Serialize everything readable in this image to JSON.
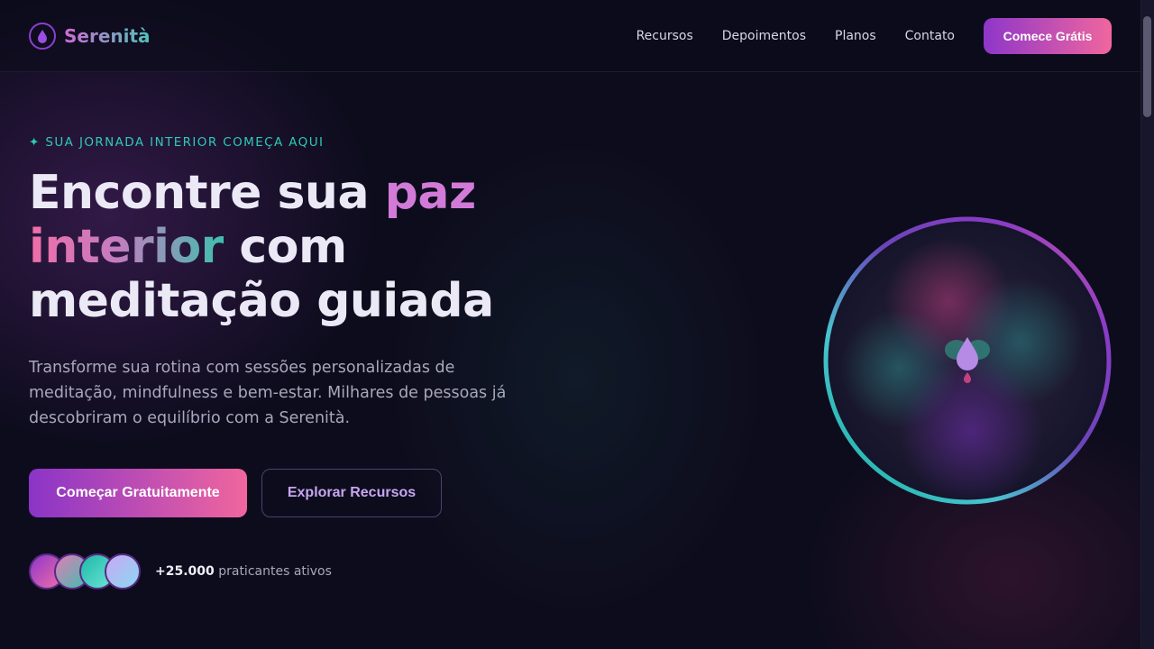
{
  "brand": {
    "name": "Serenità"
  },
  "nav": {
    "items": [
      "Recursos",
      "Depoimentos",
      "Planos",
      "Contato"
    ],
    "cta": "Comece Grátis"
  },
  "hero": {
    "eyebrow": "✦ SUA JORNADA INTERIOR COMEÇA AQUI",
    "title": {
      "part1": "Encontre sua ",
      "highlight1": "paz",
      "highlight2": "interior",
      "part2": " com",
      "part3": "meditação guiada"
    },
    "lead": "Transforme sua rotina com sessões personalizadas de meditação, mindfulness e bem-estar. Milhares de pessoas já descobriram o equilíbrio com a Serenità.",
    "primary_button": "Começar Gratuitamente",
    "secondary_button": "Explorar Recursos",
    "social_count": "+25.000",
    "social_label": " praticantes ativos"
  },
  "colors": {
    "background": "#0d0c1d",
    "accent_purple": "#8e36c9",
    "accent_pink": "#f0669e",
    "accent_teal": "#2ec9b6"
  },
  "icons": {
    "logo": "water-drop-icon",
    "orb": "lotus-drop-icon"
  }
}
